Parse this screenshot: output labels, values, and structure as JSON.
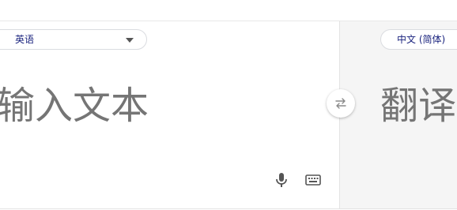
{
  "source": {
    "language_label": "英语",
    "placeholder": "输入文本"
  },
  "target": {
    "language_label": "中文 (简体)",
    "placeholder": "翻译"
  },
  "icons": {
    "dropdown": "chevron-down-icon",
    "swap": "swap-icon",
    "microphone": "microphone-icon",
    "keyboard": "keyboard-icon"
  },
  "colors": {
    "language_text": "#1a237e",
    "placeholder_text": "#757575",
    "target_panel_bg": "#f5f5f5",
    "icon_gray": "#555555"
  }
}
